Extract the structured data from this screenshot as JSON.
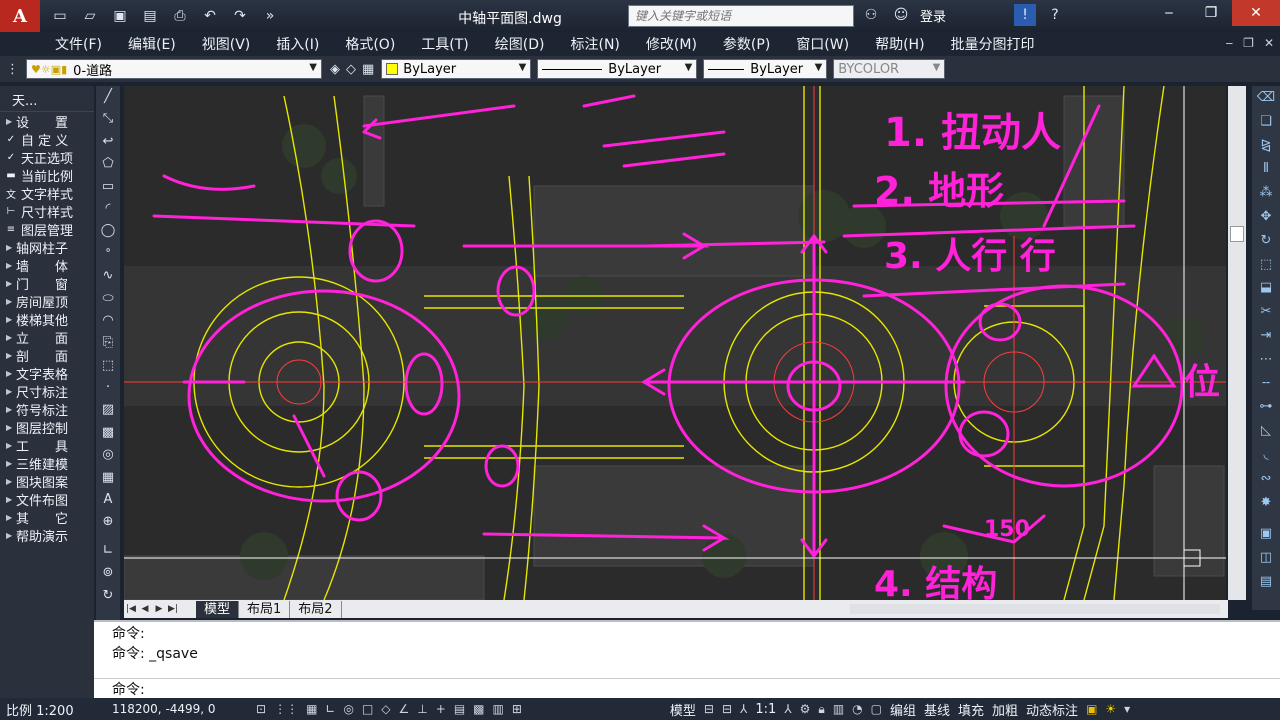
{
  "app": {
    "logo_letter": "A",
    "title": "中轴平面图.dwg",
    "search_placeholder": "键入关键字或短语",
    "login": "登录"
  },
  "menu": [
    "文件(F)",
    "编辑(E)",
    "视图(V)",
    "插入(I)",
    "格式(O)",
    "工具(T)",
    "绘图(D)",
    "标注(N)",
    "修改(M)",
    "参数(P)",
    "窗口(W)",
    "帮助(H)",
    "批量分图打印"
  ],
  "toolbar": {
    "layer": "0-道路",
    "color": "ByLayer",
    "linetype": "ByLayer",
    "lineweight": "ByLayer",
    "plotstyle": "BYCOLOR"
  },
  "sidebar": {
    "title": "天...",
    "items": [
      {
        "label": "设　　置",
        "kind": "section"
      },
      {
        "label": "自 定 义",
        "kind": "tool"
      },
      {
        "label": "天正选项",
        "kind": "tool"
      },
      {
        "label": "当前比例",
        "kind": "tool"
      },
      {
        "label": "文字样式",
        "kind": "tool"
      },
      {
        "label": "尺寸样式",
        "kind": "tool"
      },
      {
        "label": "图层管理",
        "kind": "tool"
      },
      {
        "label": "轴网柱子",
        "kind": "section"
      },
      {
        "label": "墙　　体",
        "kind": "section"
      },
      {
        "label": "门　　窗",
        "kind": "section"
      },
      {
        "label": "房间屋顶",
        "kind": "section"
      },
      {
        "label": "楼梯其他",
        "kind": "section"
      },
      {
        "label": "立　　面",
        "kind": "section"
      },
      {
        "label": "剖　　面",
        "kind": "section"
      },
      {
        "label": "文字表格",
        "kind": "section"
      },
      {
        "label": "尺寸标注",
        "kind": "section"
      },
      {
        "label": "符号标注",
        "kind": "section"
      },
      {
        "label": "图层控制",
        "kind": "section"
      },
      {
        "label": "工　　具",
        "kind": "section"
      },
      {
        "label": "三维建模",
        "kind": "section"
      },
      {
        "label": "图块图案",
        "kind": "section"
      },
      {
        "label": "文件布图",
        "kind": "section"
      },
      {
        "label": "其　　它",
        "kind": "section"
      },
      {
        "label": "帮助演示",
        "kind": "section"
      }
    ]
  },
  "tabs": [
    "模型",
    "布局1",
    "布局2"
  ],
  "command": {
    "line1": "命令:",
    "line2": "命令: _qsave",
    "prompt": "命令:"
  },
  "status": {
    "scale": "比例 1:200",
    "coords": "118200, -4499, 0",
    "model": "模型",
    "anno_scale": "1:1",
    "buttons": [
      "编组",
      "基线",
      "填充",
      "加粗",
      "动态标注"
    ]
  },
  "annotations": {
    "note1": "1. 扭动人",
    "note2": "2. 地形",
    "note3": "3. 人行 行",
    "note4": "4. 结构",
    "note_v": "位",
    "dim": "150"
  },
  "colors": {
    "accent_magenta": "#ff22d8",
    "cad_yellow": "#ffff00",
    "cad_red": "#ff3b3b",
    "bg_dark": "#2e2e2e"
  }
}
